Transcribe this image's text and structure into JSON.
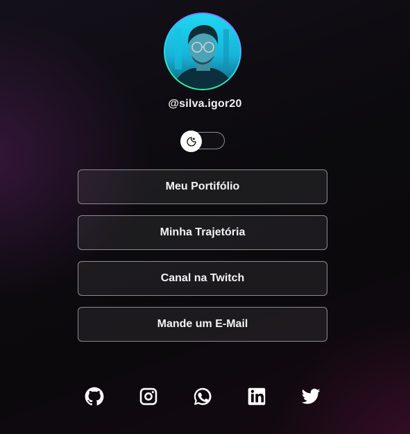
{
  "profile": {
    "username": "@silva.igor20"
  },
  "theme_toggle": {
    "state": "dark",
    "icon": "moon-sun-icon"
  },
  "links": [
    {
      "label": "Meu Portifólio"
    },
    {
      "label": "Minha Trajetória"
    },
    {
      "label": "Canal na Twitch"
    },
    {
      "label": "Mande um E-Mail"
    }
  ],
  "socials": [
    {
      "icon": "github-icon"
    },
    {
      "icon": "instagram-icon"
    },
    {
      "icon": "whatsapp-icon"
    },
    {
      "icon": "linkedin-icon"
    },
    {
      "icon": "twitter-icon"
    }
  ],
  "colors": {
    "background": "#0b0a0d",
    "button_border": "#8d8c92",
    "text": "#ffffff",
    "avatar_ring_start": "#a35bff",
    "avatar_ring_end": "#2bff7a"
  }
}
